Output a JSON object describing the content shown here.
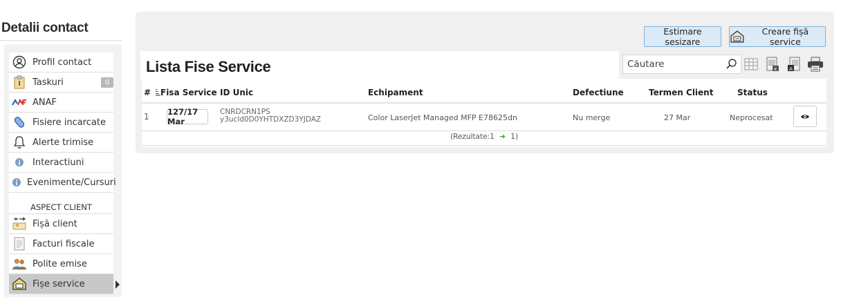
{
  "sidebar": {
    "title": "Detalii contact",
    "items": [
      {
        "label": "Profil contact",
        "icon": "user-circle-icon"
      },
      {
        "label": "Taskuri",
        "icon": "clipboard-icon",
        "badge": "0"
      },
      {
        "label": "ANAF",
        "icon": "anaf-logo-icon"
      },
      {
        "label": "Fisiere incarcate",
        "icon": "paperclip-icon"
      },
      {
        "label": "Alerte trimise",
        "icon": "bell-icon"
      },
      {
        "label": "Interactiuni",
        "icon": "info-icon"
      },
      {
        "label": "Evenimente/Cursuri",
        "icon": "info-icon"
      }
    ],
    "section_label": "ASPECT CLIENT",
    "section_items": [
      {
        "label": "Fișă client",
        "icon": "client-card-icon"
      },
      {
        "label": "Facturi fiscale",
        "icon": "invoice-icon"
      },
      {
        "label": "Polite emise",
        "icon": "people-icon"
      },
      {
        "label": "Fișe service",
        "icon": "service-box-icon",
        "active": true
      }
    ]
  },
  "toolbar": {
    "estimare_label": "Estimare sesizare",
    "creare_label": "Creare fișă service",
    "search_placeholder": "Căutare"
  },
  "list": {
    "title": "Lista Fise Service",
    "columns": {
      "nr": "#",
      "fisa": "Fisa Service",
      "id_unic": "ID Unic",
      "echipament": "Echipament",
      "defectiune": "Defectiune",
      "termen": "Termen Client",
      "status": "Status"
    },
    "rows": [
      {
        "nr": "1",
        "fisa": "127/17 Mar",
        "id_unic": "CNRDCRN1PS y3ucld0D0YHTDXZD3YJDAZ",
        "echipament": "Color LaserJet Managed MFP E78625dn",
        "defectiune": "Nu merge",
        "termen": "27 Mar",
        "status": "Neprocesat"
      }
    ],
    "footer_prefix": "(Rezultate:1",
    "footer_suffix": "1)"
  },
  "colors": {
    "button_bg": "#dbeaf7",
    "button_border": "#7fb1d9",
    "panel_bg": "#f0f0f0",
    "active_item_bg": "#c8c8c8",
    "arrow_green": "#3e9b2a"
  }
}
